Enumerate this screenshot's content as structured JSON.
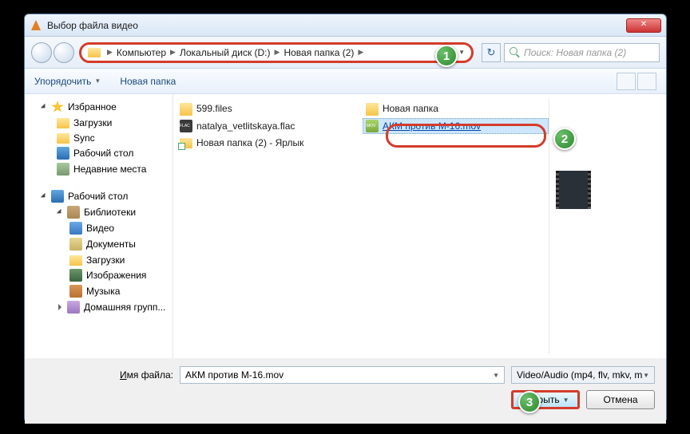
{
  "title": "Выбор файла видео",
  "breadcrumb": {
    "root": "Компьютер",
    "drive": "Локальный диск (D:)",
    "folder": "Новая папка (2)"
  },
  "search_placeholder": "Поиск: Новая папка (2)",
  "cmdbar": {
    "organize": "Упорядочить",
    "newfolder": "Новая папка"
  },
  "sidebar": {
    "favorites": {
      "label": "Избранное",
      "items": [
        "Загрузки",
        "Sync",
        "Рабочий стол",
        "Недавние места"
      ]
    },
    "desktop": {
      "label": "Рабочий стол"
    },
    "libraries": {
      "label": "Библиотеки",
      "items": [
        "Видео",
        "Документы",
        "Загрузки",
        "Изображения",
        "Музыка"
      ]
    },
    "homegroup": {
      "label": "Домашняя групп..."
    }
  },
  "files": {
    "col1": [
      {
        "name": "599.files",
        "icon": "folder"
      },
      {
        "name": "natalya_vetlitskaya.flac",
        "icon": "flac"
      },
      {
        "name": "Новая папка (2) - Ярлык",
        "icon": "link"
      }
    ],
    "col2": [
      {
        "name": "Новая папка",
        "icon": "folder"
      },
      {
        "name": "АКМ против М-16.mov",
        "icon": "mov",
        "selected": true
      }
    ]
  },
  "footer": {
    "label": "Имя файла:",
    "filename": "АКМ против М-16.mov",
    "filter": "Video/Audio (mp4, flv, mkv, m",
    "open": "Открыть",
    "cancel": "Отмена"
  },
  "badges": {
    "b1": "1",
    "b2": "2",
    "b3": "3"
  }
}
